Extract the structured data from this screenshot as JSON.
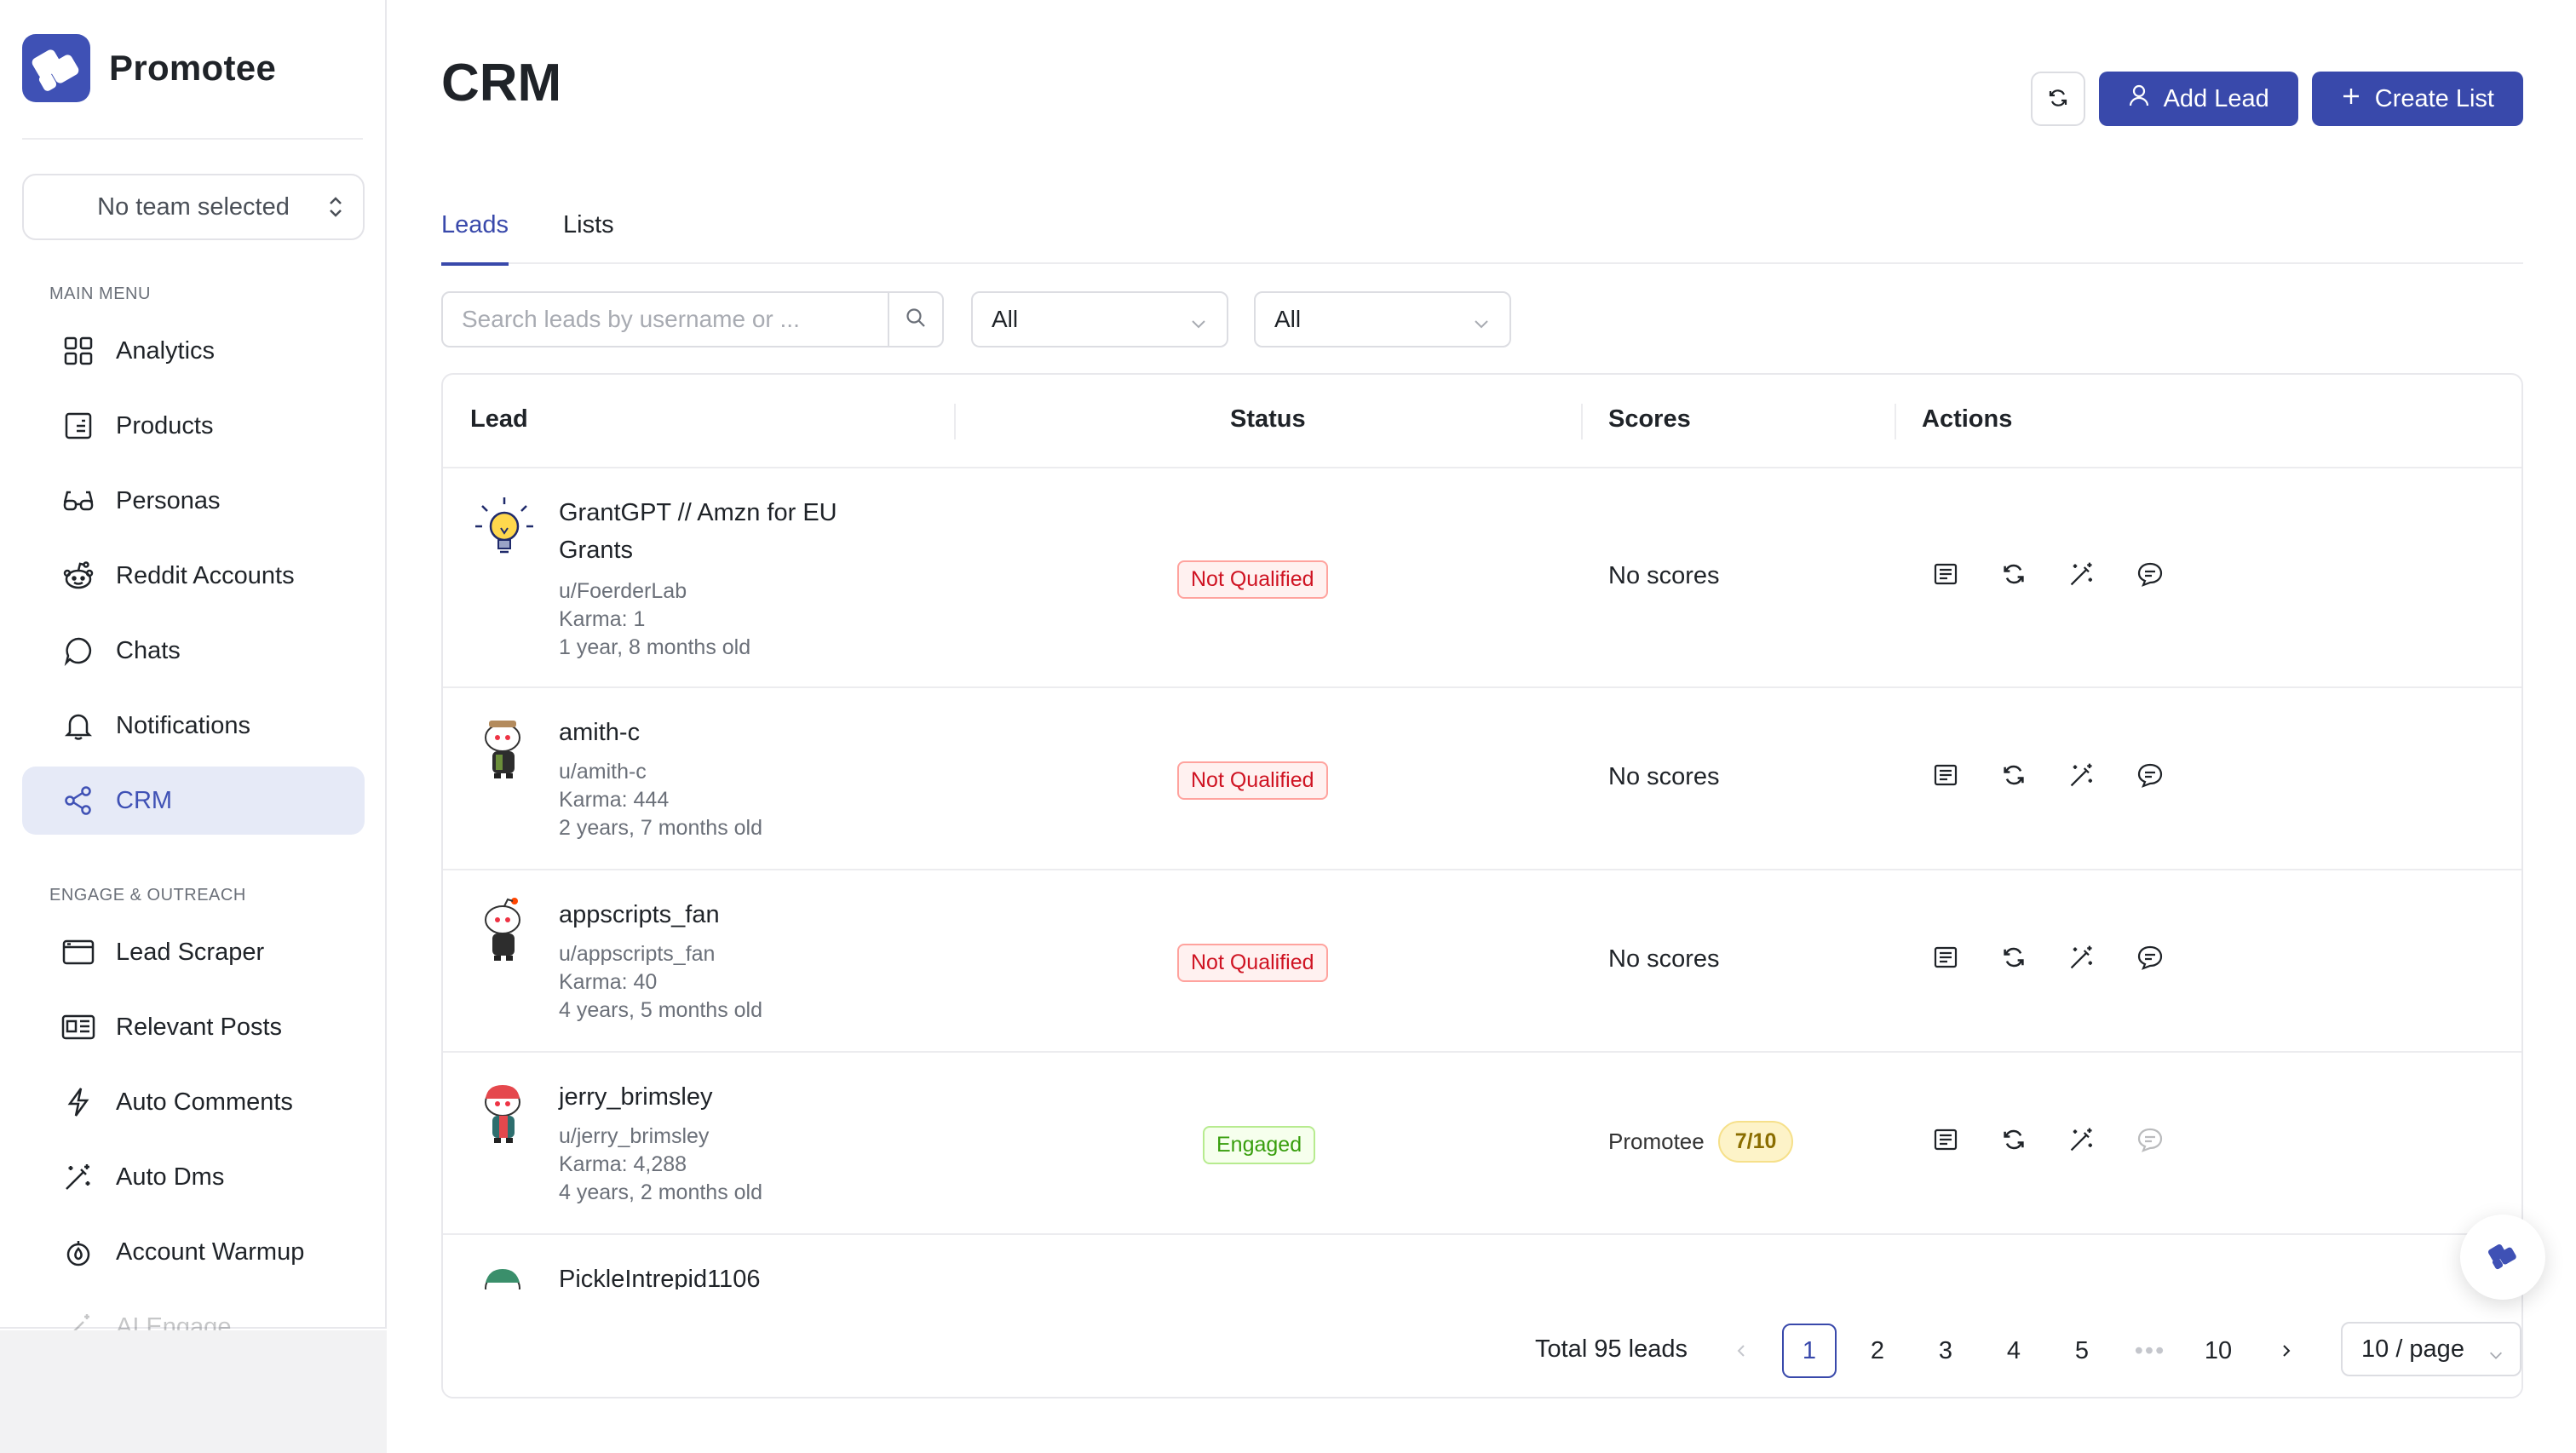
{
  "brand": {
    "name": "Promotee"
  },
  "team_select": {
    "value": "No team selected"
  },
  "sections": {
    "main_menu": "MAIN MENU",
    "engage": "ENGAGE & OUTREACH"
  },
  "nav_main": [
    {
      "label": "Analytics",
      "icon": "grid-icon"
    },
    {
      "label": "Products",
      "icon": "product-icon"
    },
    {
      "label": "Personas",
      "icon": "glasses-icon"
    },
    {
      "label": "Reddit Accounts",
      "icon": "reddit-icon"
    },
    {
      "label": "Chats",
      "icon": "chat-icon"
    },
    {
      "label": "Notifications",
      "icon": "bell-icon"
    },
    {
      "label": "CRM",
      "icon": "share-icon",
      "active": true
    }
  ],
  "nav_engage": [
    {
      "label": "Lead Scraper",
      "icon": "browser-icon"
    },
    {
      "label": "Relevant Posts",
      "icon": "newspaper-icon"
    },
    {
      "label": "Auto Comments",
      "icon": "bolt-icon"
    },
    {
      "label": "Auto Dms",
      "icon": "wand-icon"
    },
    {
      "label": "Account Warmup",
      "icon": "flame-icon"
    },
    {
      "label": "AI Engage",
      "icon": "sparkle-icon"
    }
  ],
  "page": {
    "title": "CRM"
  },
  "header_buttons": {
    "add_lead": "Add Lead",
    "create_list": "Create List"
  },
  "tabs": [
    {
      "label": "Leads",
      "active": true
    },
    {
      "label": "Lists"
    }
  ],
  "search": {
    "placeholder": "Search leads by username or ..."
  },
  "filters": {
    "first": "All",
    "second": "All"
  },
  "table": {
    "columns": {
      "lead": "Lead",
      "status": "Status",
      "scores": "Scores",
      "actions": "Actions"
    },
    "rows": [
      {
        "name": "GrantGPT // Amzn for EU Grants",
        "username": "u/FoerderLab",
        "karma": "Karma: 1",
        "age": "1 year, 8 months old",
        "status": "Not Qualified",
        "status_type": "nq",
        "scores": "No scores",
        "avatar": "lightbulb"
      },
      {
        "name": "amith-c",
        "username": "u/amith-c",
        "karma": "Karma: 444",
        "age": "2 years, 7 months old",
        "status": "Not Qualified",
        "status_type": "nq",
        "scores": "No scores",
        "avatar": "snoo-hat"
      },
      {
        "name": "appscripts_fan",
        "username": "u/appscripts_fan",
        "karma": "Karma: 40",
        "age": "4 years, 5 months old",
        "status": "Not Qualified",
        "status_type": "nq",
        "scores": "No scores",
        "avatar": "snoo-default"
      },
      {
        "name": "jerry_brimsley",
        "username": "u/jerry_brimsley",
        "karma": "Karma: 4,288",
        "age": "4 years, 2 months old",
        "status": "Engaged",
        "status_type": "eng",
        "score_label": "Promotee",
        "score_value": "7/10",
        "avatar": "snoo-red"
      },
      {
        "name": "PickleIntrepid1106",
        "avatar": "snoo-green"
      }
    ]
  },
  "pagination": {
    "total": "Total 95 leads",
    "pages": [
      "1",
      "2",
      "3",
      "4",
      "5",
      "10"
    ],
    "current": "1",
    "ellipsis": "•••",
    "per_page": "10 / page"
  },
  "colors": {
    "primary": "#3949ab",
    "active_nav_bg": "#e6eaf7",
    "danger": "#cf1322",
    "success": "#389e0d"
  }
}
